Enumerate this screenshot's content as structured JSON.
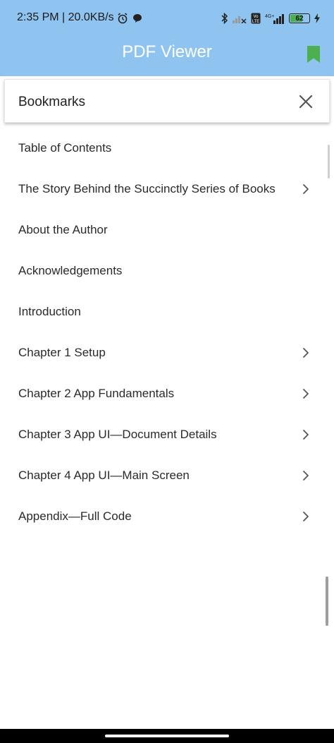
{
  "status_bar": {
    "time": "2:35 PM | 20.0KB/s",
    "battery_level": "62",
    "icons": [
      "alarm-icon",
      "chat-bubble-icon",
      "bluetooth-icon",
      "signal-x-icon",
      "volte-icon",
      "4g-signal-icon",
      "battery-icon",
      "charging-icon"
    ]
  },
  "app_bar": {
    "title": "PDF Viewer",
    "bookmark_icon": "bookmark-icon",
    "bookmark_color": "#4caf50",
    "background": "#90c4f0"
  },
  "bookmarks_panel": {
    "title": "Bookmarks",
    "close_icon": "close-icon",
    "items": [
      {
        "label": "Table of Contents",
        "has_children": false
      },
      {
        "label": "The Story Behind the Succinctly Series  of Books",
        "has_children": true
      },
      {
        "label": "About the Author",
        "has_children": false
      },
      {
        "label": "Acknowledgements",
        "has_children": false
      },
      {
        "label": "Introduction",
        "has_children": false
      },
      {
        "label": "Chapter 1  Setup",
        "has_children": true
      },
      {
        "label": "Chapter 2  App Fundamentals",
        "has_children": true
      },
      {
        "label": "Chapter 3  App UI—Document Details",
        "has_children": true
      },
      {
        "label": "Chapter 4  App UI—Main Screen",
        "has_children": true
      },
      {
        "label": "Appendix—Full Code",
        "has_children": true
      }
    ]
  }
}
